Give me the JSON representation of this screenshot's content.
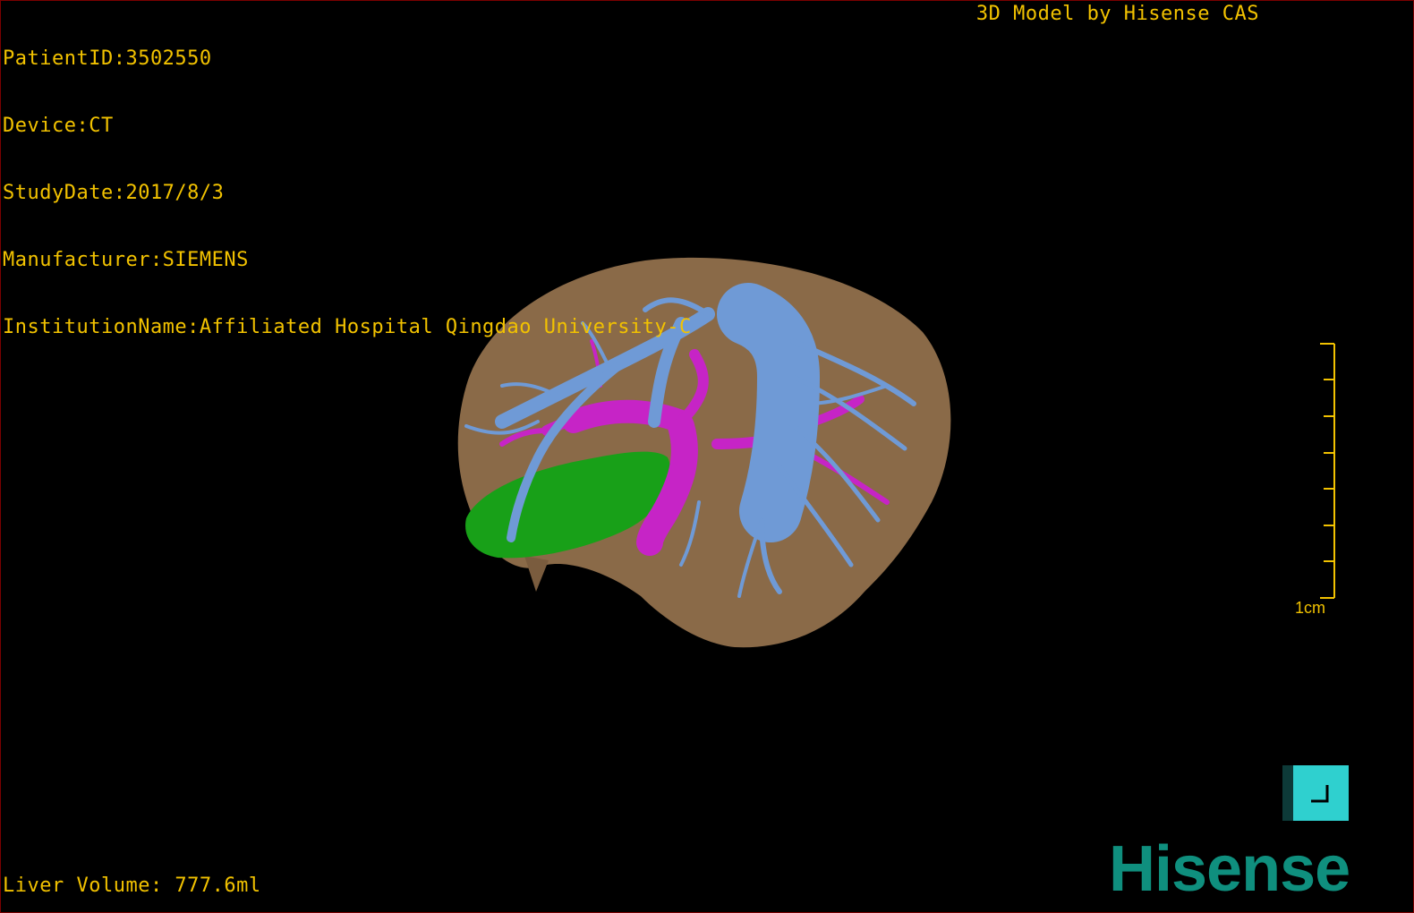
{
  "overlay": {
    "patient_id": "PatientID:3502550",
    "device": "Device:CT",
    "study_date": "StudyDate:2017/8/3",
    "manufacturer": "Manufacturer:SIEMENS",
    "institution": "InstitutionName:Affiliated Hospital Qingdao University-C",
    "credit": "3D Model by Hisense CAS",
    "liver_volume": "Liver Volume: 777.6ml"
  },
  "scale_bar": {
    "label": "1cm"
  },
  "logo": {
    "text": "Hisense"
  },
  "colors": {
    "overlay_text": "#f2c200",
    "liver": "#8a6a48",
    "hepatic_vein": "#6f9ad6",
    "portal_vein": "#c624c6",
    "gallbladder": "#18a018",
    "orientation_button": "#2fd0cf",
    "logo": "#0f8f7e"
  }
}
